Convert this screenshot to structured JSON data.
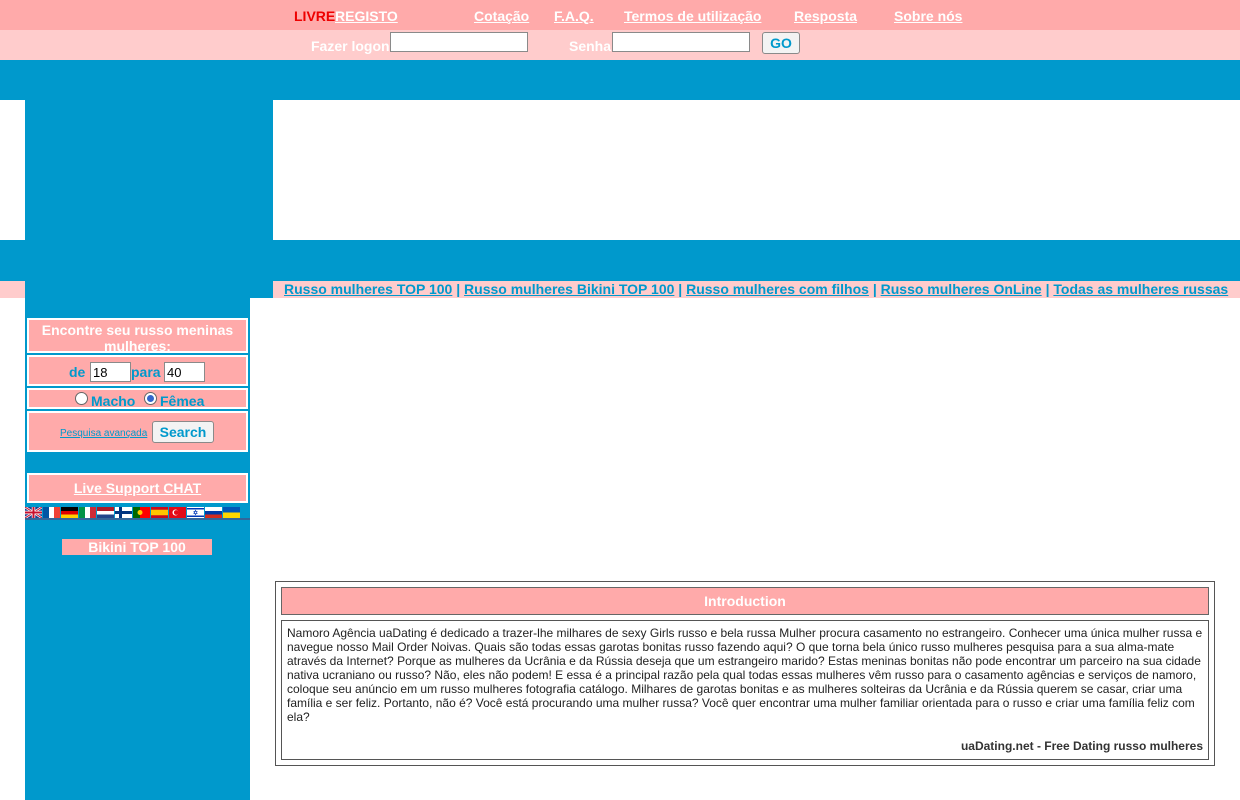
{
  "topbar": {
    "livre": "LIVRE",
    "registo": "REGISTO",
    "links": [
      "Cotação",
      "F.A.Q.",
      "Termos de utilização",
      "Resposta",
      "Sobre nós"
    ]
  },
  "login": {
    "user_label": "Fazer logon",
    "pass_label": "Senha",
    "go_label": "GO"
  },
  "nav": {
    "links": [
      "Russo mulheres TOP 100",
      "Russo mulheres Bikini TOP 100",
      "Russo mulheres com filhos",
      "Russo mulheres OnLine",
      "Todas as mulheres russas"
    ],
    "separator": "|"
  },
  "search": {
    "title": "Encontre seu russo meninas mulheres:",
    "from_label": "de",
    "from_value": "18",
    "to_label": "para",
    "to_value": "40",
    "male_label": "Macho",
    "female_label": "Fêmea",
    "selected": "Fêmea",
    "advanced_label": "Pesquisa avançada",
    "button_label": "Search"
  },
  "chat_label": "Live Support CHAT",
  "flags": [
    "uk-flag-icon",
    "france-flag-icon",
    "germany-flag-icon",
    "italy-flag-icon",
    "netherlands-flag-icon",
    "finland-flag-icon",
    "portugal-flag-icon",
    "spain-flag-icon",
    "turkey-flag-icon",
    "israel-flag-icon",
    "russia-flag-icon",
    "ukraine-flag-icon"
  ],
  "bikini_label": "Bikini TOP 100",
  "intro": {
    "title": "Introduction",
    "body": "Namoro Agência uaDating é dedicado a trazer-lhe milhares de sexy Girls russo e bela russa Mulher procura casamento no estrangeiro. Conhecer uma única mulher russa e navegue nosso Mail Order Noivas. Quais são todas essas garotas bonitas russo fazendo aqui? O que torna bela único russo mulheres pesquisa para a sua alma-mate através da Internet? Porque as mulheres da Ucrânia e da Rússia deseja que um estrangeiro marido? Estas meninas bonitas não pode encontrar um parceiro na sua cidade nativa ucraniano ou russo? Não, eles não podem! E essa é a principal razão pela qual todas essas mulheres vêm russo para o casamento agências e serviços de namoro, coloque seu anúncio em um russo mulheres fotografia catálogo. Milhares de garotas bonitas e as mulheres solteiras da Ucrânia e da Rússia querem se casar, criar uma família e ser feliz. Portanto, não é? Você está procurando uma mulher russa? Você quer encontrar uma mulher familiar orientada para o russo e criar uma família feliz com ela?",
    "signature": "uaDating.net - Free Dating russo mulheres"
  },
  "colors": {
    "blue": "#0099cc",
    "pink": "#ffaaaa",
    "light_pink": "#ffcccc",
    "red": "#ee0000"
  }
}
